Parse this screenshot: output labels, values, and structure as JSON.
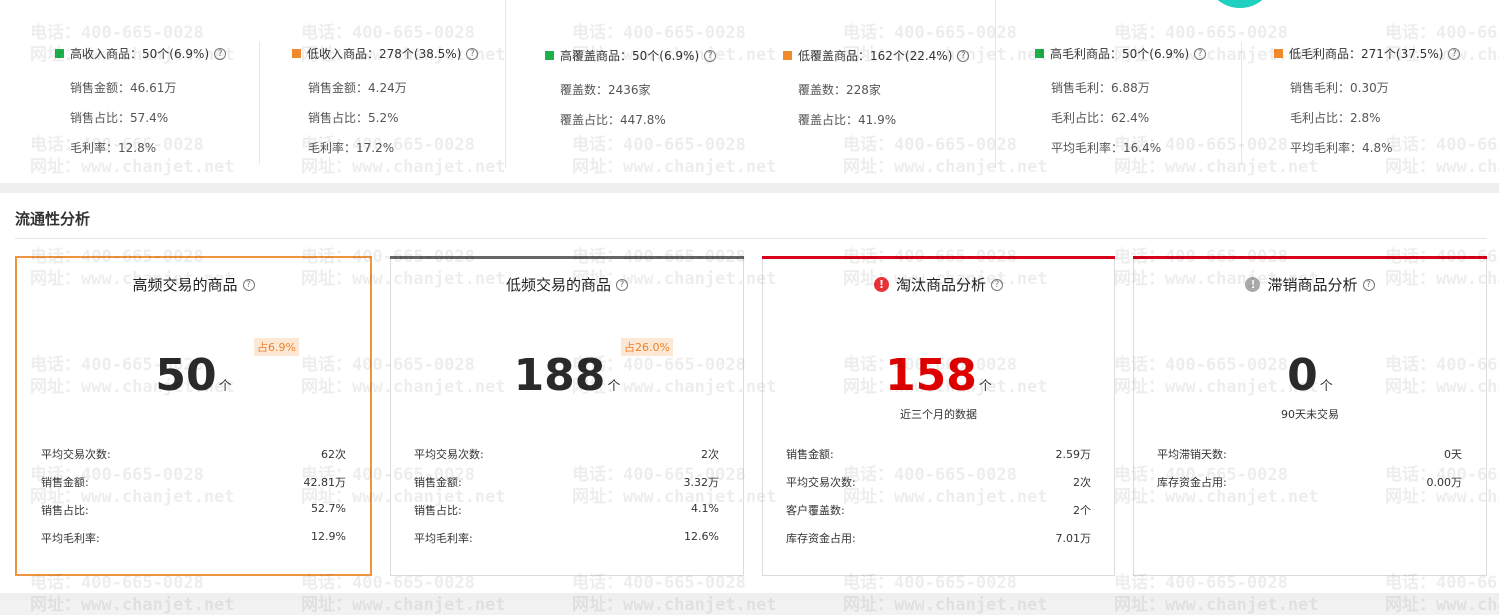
{
  "summary": [
    {
      "color": "green",
      "title": "高收入商品：50个(6.9%)",
      "lines": [
        "销售金额：46.61万",
        "销售占比：57.4%",
        "毛利率：12.8%"
      ]
    },
    {
      "color": "orange",
      "title": "低收入商品：278个(38.5%)",
      "lines": [
        "销售金额：4.24万",
        "销售占比：5.2%",
        "毛利率：17.2%"
      ]
    },
    {
      "color": "green",
      "title": "高覆盖商品：50个(6.9%)",
      "lines": [
        "覆盖数：2436家",
        "覆盖占比：447.8%"
      ]
    },
    {
      "color": "orange",
      "title": "低覆盖商品：162个(22.4%)",
      "lines": [
        "覆盖数：228家",
        "覆盖占比：41.9%"
      ]
    },
    {
      "color": "green",
      "title": "高毛利商品：50个(6.9%)",
      "lines": [
        "销售毛利：6.88万",
        "毛利占比：62.4%",
        "平均毛利率：16.4%"
      ]
    },
    {
      "color": "orange",
      "title": "低毛利商品：271个(37.5%)",
      "lines": [
        "销售毛利：0.30万",
        "毛利占比：2.8%",
        "平均毛利率：4.8%"
      ]
    }
  ],
  "section_title": "流通性分析",
  "cards": [
    {
      "title": "高频交易的商品",
      "number": "50",
      "unit": "个",
      "ratio": "占6.9%",
      "note": "",
      "rows": [
        {
          "label": "平均交易次数:",
          "value": "62次"
        },
        {
          "label": "销售金额:",
          "value": "42.81万"
        },
        {
          "label": "销售占比:",
          "value": "52.7%"
        },
        {
          "label": "平均毛利率:",
          "value": "12.9%"
        }
      ]
    },
    {
      "title": "低频交易的商品",
      "number": "188",
      "unit": "个",
      "ratio": "占26.0%",
      "note": "",
      "rows": [
        {
          "label": "平均交易次数:",
          "value": "2次"
        },
        {
          "label": "销售金额:",
          "value": "3.32万"
        },
        {
          "label": "销售占比:",
          "value": "4.1%"
        },
        {
          "label": "平均毛利率:",
          "value": "12.6%"
        }
      ]
    },
    {
      "title": "淘汰商品分析",
      "number": "158",
      "unit": "个",
      "ratio": "",
      "note": "近三个月的数据",
      "rows": [
        {
          "label": "销售金额:",
          "value": "2.59万"
        },
        {
          "label": "平均交易次数:",
          "value": "2次"
        },
        {
          "label": "客户覆盖数:",
          "value": "2个"
        },
        {
          "label": "库存资金占用:",
          "value": "7.01万"
        }
      ]
    },
    {
      "title": "滞销商品分析",
      "number": "0",
      "unit": "个",
      "ratio": "",
      "note": "90天未交易",
      "rows": [
        {
          "label": "平均滞销天数:",
          "value": "0天"
        },
        {
          "label": "库存资金占用:",
          "value": "0.00万"
        }
      ]
    }
  ],
  "watermark": {
    "phone": "电话：400-665-0028",
    "site": "网址：www.chanjet.net"
  },
  "colors": {
    "green": "#1db14b",
    "orange": "#f28a2d",
    "red": "#e00000",
    "card_gray_top": "#666666",
    "card_red_top": "#d9001b",
    "selected_border": "#f0953f"
  },
  "icons": {
    "help": "question-circle-icon",
    "alert": "exclamation-circle-icon"
  }
}
